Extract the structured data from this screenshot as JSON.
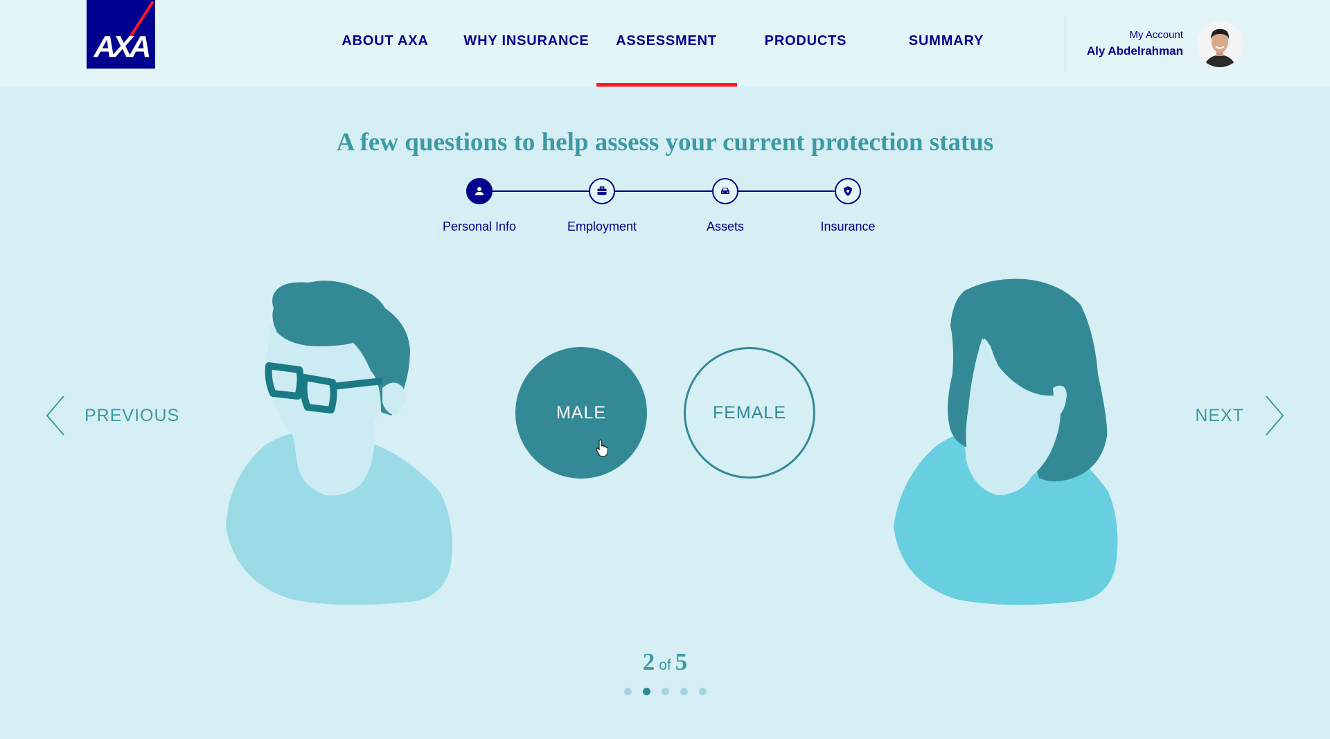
{
  "header": {
    "logo_text": "AXA",
    "nav": [
      {
        "label": "ABOUT AXA",
        "active": false
      },
      {
        "label": "WHY INSURANCE",
        "active": false
      },
      {
        "label": "ASSESSMENT",
        "active": true
      },
      {
        "label": "PRODUCTS",
        "active": false
      },
      {
        "label": "SUMMARY",
        "active": false
      }
    ],
    "account_label": "My Account",
    "account_name": "Aly Abdelrahman"
  },
  "title": "A few questions to help assess your current protection status",
  "stepper": {
    "steps": [
      {
        "label": "Personal Info",
        "icon": "person-icon",
        "active": true
      },
      {
        "label": "Employment",
        "icon": "briefcase-icon",
        "active": false
      },
      {
        "label": "Assets",
        "icon": "car-icon",
        "active": false
      },
      {
        "label": "Insurance",
        "icon": "shield-icon",
        "active": false
      }
    ]
  },
  "question": {
    "options": [
      {
        "label": "MALE",
        "selected": true
      },
      {
        "label": "FEMALE",
        "selected": false
      }
    ]
  },
  "navigation": {
    "previous": "PREVIOUS",
    "next": "NEXT"
  },
  "pager": {
    "current": "2",
    "of": "of",
    "total": "5",
    "dots": 5,
    "active_dot": 2
  },
  "colors": {
    "brand_blue": "#00008f",
    "brand_red": "#ff1721",
    "teal": "#338a96",
    "teal_light": "#3d9aa5",
    "background": "#d6eff4"
  }
}
